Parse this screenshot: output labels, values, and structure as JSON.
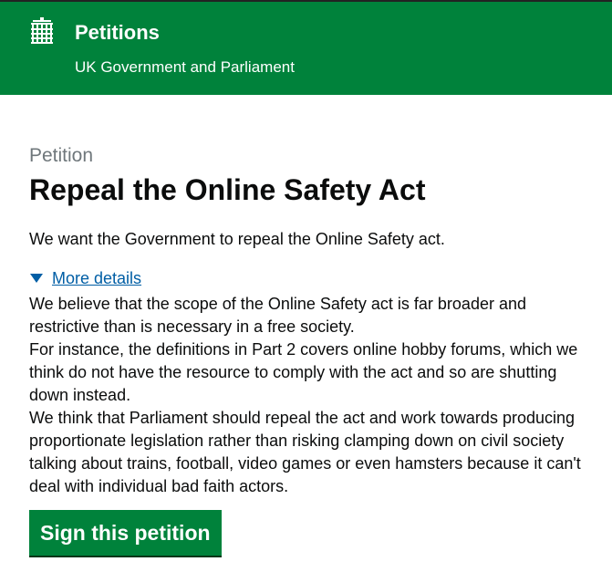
{
  "header": {
    "logo_icon": "portcullis-icon",
    "title": "Petitions",
    "subtitle": "UK Government and Parliament",
    "background_color": "#00823b"
  },
  "petition": {
    "caption": "Petition",
    "title": "Repeal the Online Safety Act",
    "action": "We want the Government to repeal the Online Safety act.",
    "details_toggle_icon": "triangle-down-icon",
    "details_label": "More details",
    "details_paragraphs": [
      "We believe that the scope of the Online Safety act is far broader and restrictive than is necessary in a free society.",
      "For instance, the definitions in Part 2 covers online hobby forums, which we think do not have the resource to comply with the act and so are shutting down instead.",
      "We think that Parliament should repeal the act and work towards producing proportionate legislation rather than risking clamping down on civil society talking about trains, football, video games or even hamsters because it can't deal with individual bad faith actors."
    ],
    "sign_button_label": "Sign this petition",
    "link_color": "#005ea5"
  }
}
